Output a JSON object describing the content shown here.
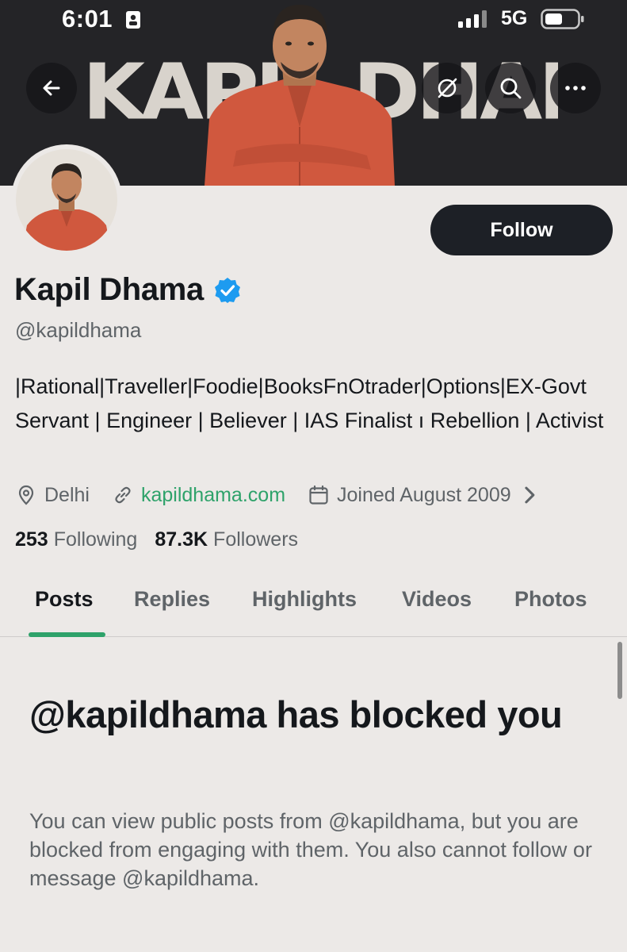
{
  "status_bar": {
    "time": "6:01",
    "network": "5G"
  },
  "banner": {
    "title_text": "KAPIL DHAMA",
    "buttons": {
      "back_icon": "arrow-left-icon",
      "grok_icon": "circle-slash-icon",
      "search_icon": "search-icon",
      "more_icon": "more-horizontal-icon"
    }
  },
  "profile": {
    "display_name": "Kapil Dhama",
    "handle": "@kapildhama",
    "follow_label": "Follow",
    "bio": "|Rational|Traveller|Foodie|BooksFnOtrader|Options|EX-Govt Servant | Engineer | Believer | IAS Finalist ı Rebellion | Activist",
    "location": "Delhi",
    "website": "kapildhama.com",
    "joined": "Joined August 2009",
    "following_count": "253",
    "following_label": "Following",
    "followers_count": "87.3K",
    "followers_label": "Followers"
  },
  "tabs": [
    {
      "label": "Posts",
      "active": true
    },
    {
      "label": "Replies",
      "active": false
    },
    {
      "label": "Highlights",
      "active": false
    },
    {
      "label": "Videos",
      "active": false
    },
    {
      "label": "Photos",
      "active": false
    }
  ],
  "blocked_notice": {
    "title": "@kapildhama has blocked you",
    "description": "You can view public posts from @kapildhama, but you are blocked from engaging with them. You also cannot follow or message @kapildhama."
  },
  "colors": {
    "background": "#ece9e7",
    "banner": "#242427",
    "accent_green": "#2ea26a",
    "follow_button": "#1d2026",
    "verified_blue": "#1d9bf0",
    "text_primary": "#15181c",
    "text_secondary": "#5f6468"
  }
}
